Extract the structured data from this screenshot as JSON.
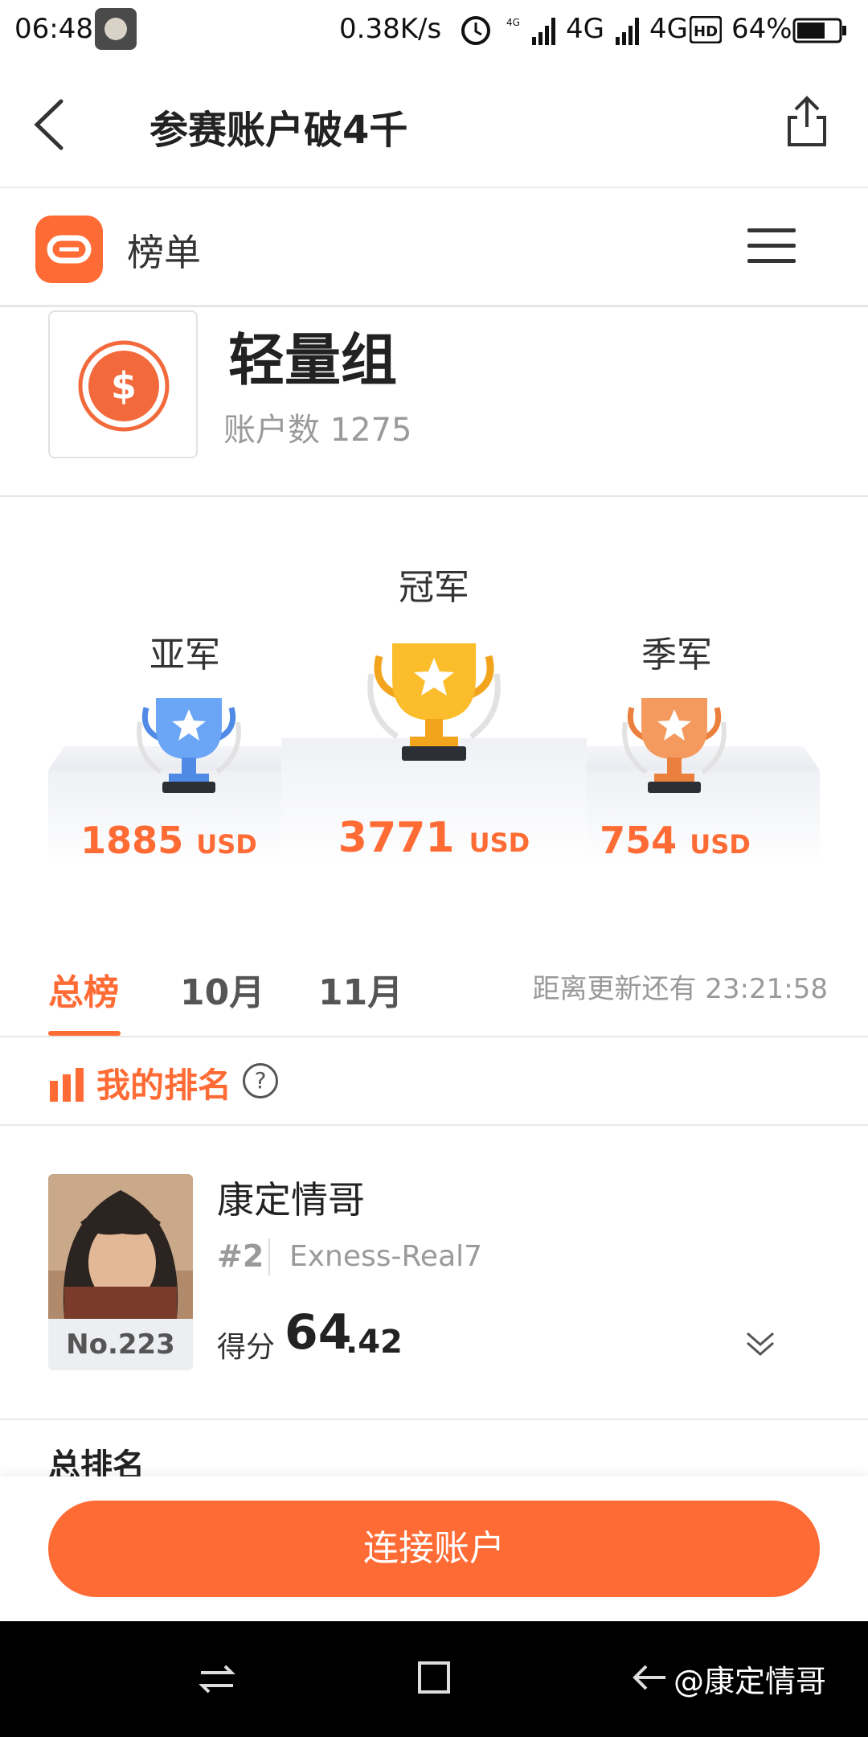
{
  "status_bar": {
    "time": "06:48",
    "speed": "0.38K/s",
    "net1": "4G",
    "net2": "4G",
    "battery": "64%"
  },
  "nav": {
    "title": "参赛账户破4千"
  },
  "brand": {
    "name": "榜单"
  },
  "group": {
    "name": "轻量组",
    "count_label": "账户数 1275"
  },
  "podium": {
    "second": {
      "label": "亚军",
      "amount": "1885",
      "unit": "USD"
    },
    "first": {
      "label": "冠军",
      "amount": "3771",
      "unit": "USD"
    },
    "third": {
      "label": "季军",
      "amount": "754",
      "unit": "USD"
    }
  },
  "tabs": {
    "items": [
      "总榜",
      "10月",
      "11月"
    ],
    "active": 0,
    "countdown": "距离更新还有 23:21:58"
  },
  "my_rank": {
    "title": "我的排名",
    "help": "?"
  },
  "user": {
    "name": "康定情哥",
    "place": "#2",
    "account": "Exness-Real7",
    "rank_no": "No.223",
    "score_label": "得分",
    "score_int": "64",
    "score_dec": ".42"
  },
  "total_rank": {
    "title": "总排名"
  },
  "cta": {
    "label": "连接账户"
  },
  "watermark": {
    "text": "@康定情哥"
  },
  "colors": {
    "accent": "#ff6b35",
    "gold": "#f5a623",
    "silver": "#5b9cf0",
    "bronze": "#f08a4b"
  }
}
